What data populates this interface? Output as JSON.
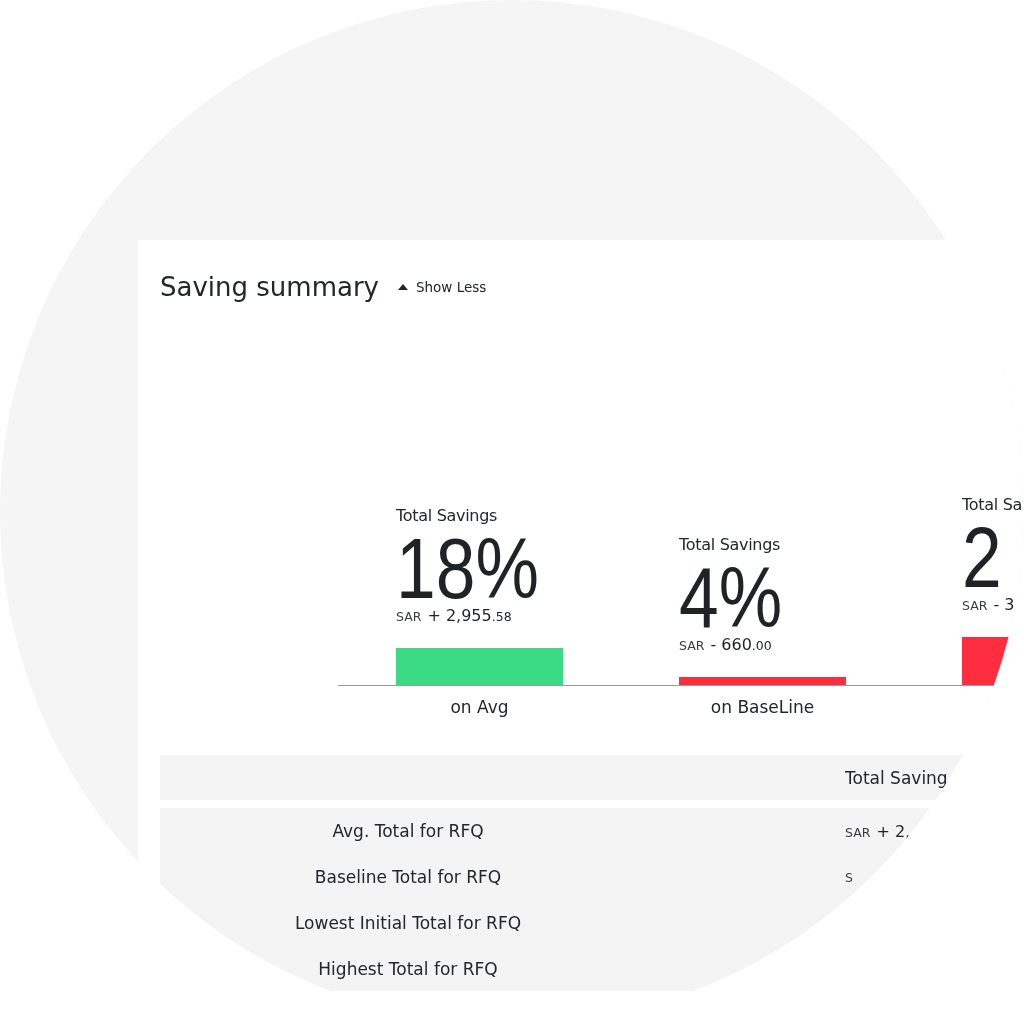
{
  "header": {
    "title": "Saving summary",
    "toggle": {
      "label": "Show Less",
      "expanded": true
    }
  },
  "summary": {
    "items": [
      {
        "heading": "Total Savings",
        "amount": {
          "currency": "SAR",
          "main": "+ 2,955",
          "decimals": ".58"
        }
      },
      {
        "heading": "Total Savings",
        "amount": {
          "currency": "SAR",
          "main": "- 660",
          "decimals": ".00"
        }
      }
    ],
    "chart_data": {
      "type": "bar",
      "categories": [
        "on Avg",
        "on BaseLine"
      ],
      "series": [
        {
          "color": "#3adb84",
          "values": [
            18,
            null
          ],
          "value_labels": [
            "18%",
            null
          ]
        },
        {
          "color": "#ff2d40",
          "values": [
            null,
            4
          ],
          "value_labels": [
            null,
            "4%"
          ]
        }
      ]
    },
    "column_3": {
      "heading": "Total Sa",
      "percent": "2",
      "amount": {
        "currency": "SAR",
        "main": "- 3"
      },
      "color": "#ff2d40"
    }
  },
  "table": {
    "columns": {
      "column_2": "Total Saving"
    },
    "rows": [
      {
        "label": "Avg. Total for RFQ",
        "value": {
          "currency": "SAR",
          "main": "+ 2,"
        }
      },
      {
        "label": "Baseline Total for RFQ",
        "value": {
          "currency": "S"
        }
      },
      {
        "label": "Lowest Initial Total for RFQ"
      },
      {
        "label": "Highest Total for RFQ"
      }
    ]
  }
}
